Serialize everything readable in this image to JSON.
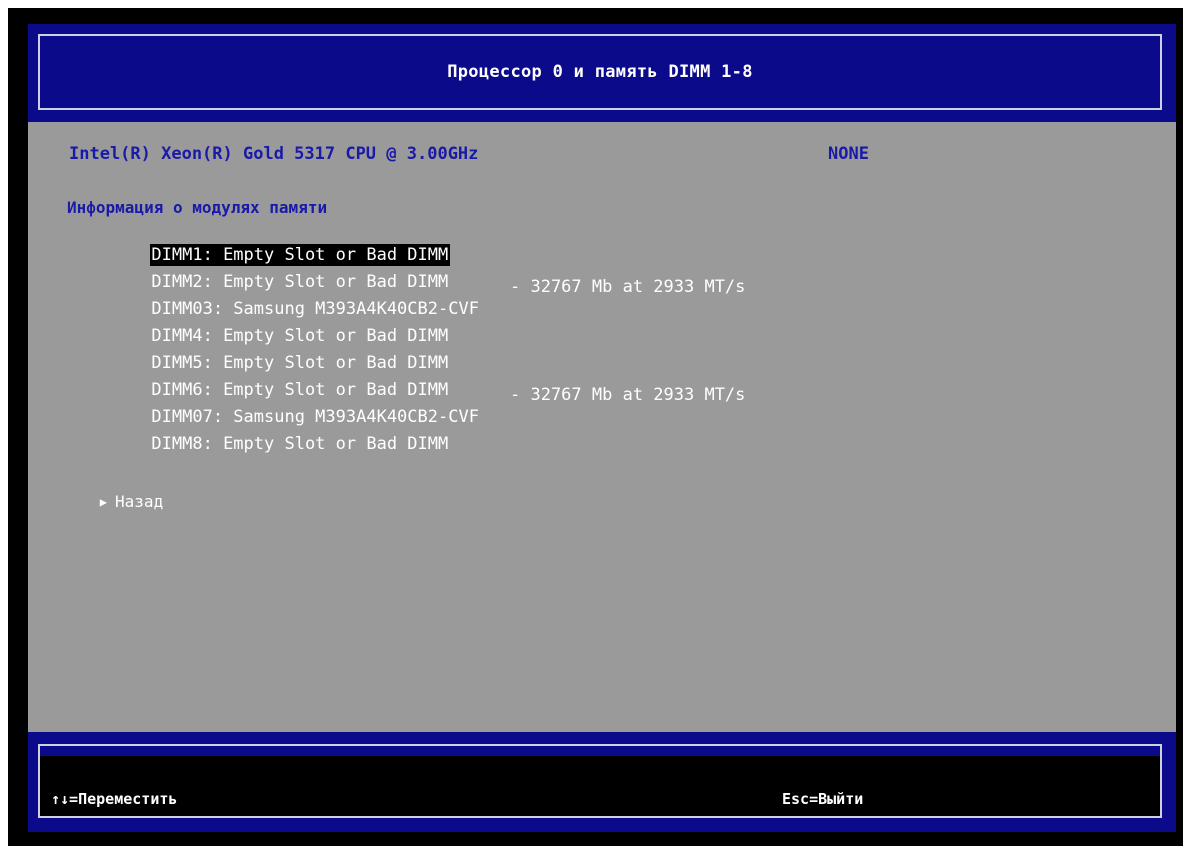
{
  "header": {
    "title": "Процессор 0 и память DIMM 1-8"
  },
  "cpu": {
    "label": "Intel(R) Xeon(R) Gold 5317 CPU @ 3.00GHz",
    "value": "NONE"
  },
  "memory": {
    "heading": "Информация о модулях памяти",
    "items": [
      {
        "slot": "DIMM1: Empty Slot or Bad DIMM",
        "size": ""
      },
      {
        "slot": "DIMM2: Empty Slot or Bad DIMM",
        "size": ""
      },
      {
        "slot": "DIMM03: Samsung M393A4K40CB2-CVF",
        "size": "- 32767 Mb at 2933 MT/s"
      },
      {
        "slot": "DIMM4: Empty Slot or Bad DIMM",
        "size": ""
      },
      {
        "slot": "DIMM5: Empty Slot or Bad DIMM",
        "size": ""
      },
      {
        "slot": "DIMM6: Empty Slot or Bad DIMM",
        "size": ""
      },
      {
        "slot": "DIMM07: Samsung M393A4K40CB2-CVF",
        "size": "- 32767 Mb at 2933 MT/s"
      },
      {
        "slot": "DIMM8: Empty Slot or Bad DIMM",
        "size": ""
      }
    ]
  },
  "nav": {
    "back_arrow_icon": "triangle-right-icon",
    "back_label": "Назад"
  },
  "footer": {
    "move_hint": "↑↓=Переместить",
    "exit_hint": "Esc=Выйти"
  },
  "colors": {
    "header_bg": "#0a0a8a",
    "panel_bg": "#9a9a9a",
    "accent_text": "#1a1aa8",
    "item_text": "#ffffff",
    "selection_bg": "#000000"
  }
}
